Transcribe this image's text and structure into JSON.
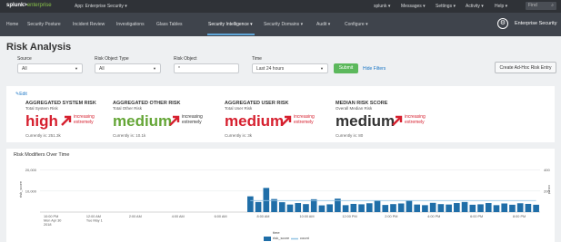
{
  "topbar": {
    "logo_main": "splunk>",
    "logo_sub": "enterprise",
    "app": "App: Enterprise Security ▾",
    "right": [
      "splunk ▾",
      "Messages ▾",
      "Settings ▾",
      "Activity ▾",
      "Help ▾"
    ],
    "find": "Find"
  },
  "nav": {
    "items": [
      "Home",
      "Security Posture",
      "Incident Review",
      "Investigations",
      "Glass Tables",
      "Security Intelligence ▾",
      "Security Domains ▾",
      "Audit ▾",
      "Configure ▾"
    ],
    "active_index": 5,
    "brand": "Enterprise Security"
  },
  "page": {
    "title": "Risk Analysis"
  },
  "filters": {
    "source_label": "Source",
    "source_value": "All",
    "type_label": "Risk Object Type",
    "type_value": "All",
    "object_label": "Risk Object",
    "object_value": "*",
    "time_label": "Time",
    "time_value": "Last 24 hours",
    "submit": "Submit",
    "hide": "Hide Filters",
    "adhoc": "Create Ad-Hoc Risk Entry"
  },
  "summary": {
    "edit": "Edit",
    "tiles": [
      {
        "heading": "AGGREGATED SYSTEM RISK",
        "sub": "Total System Risk",
        "value": "high",
        "trend1": "increasing",
        "trend2": "extremely",
        "current": "Currently is: 251.3k",
        "color": "#d6202f"
      },
      {
        "heading": "AGGREGATED OTHER RISK",
        "sub": "Total Other Risk",
        "value": "medium",
        "trend1": "increasing",
        "trend2": "extremely",
        "current": "Currently is: 10.1k",
        "color": "#65a637"
      },
      {
        "heading": "AGGREGATED USER RISK",
        "sub": "Total User Risk",
        "value": "medium",
        "trend1": "increasing",
        "trend2": "extremely",
        "current": "Currently is: 3k",
        "color": "#d6202f"
      },
      {
        "heading": "MEDIAN RISK SCORE",
        "sub": "Overall Median Risk",
        "value": "medium",
        "trend1": "increasing",
        "trend2": "extremely",
        "current": "Currently is: 80",
        "color": "#333333"
      }
    ]
  },
  "colors": {
    "bar": "#1f6ea8",
    "line": "#93c4e4",
    "trend_arrow": "#d6202f"
  },
  "chart_data": {
    "type": "bar",
    "title": "Risk Modifiers Over Time",
    "ylabel": "risk_score",
    "y2label": "count",
    "xlabel": "time",
    "left_ticks": [
      "20,000",
      "10,000"
    ],
    "right_ticks": [
      "400",
      "200"
    ],
    "x_ticks": [
      "10:00 PM\nMon Apr 30\n2018",
      "12:00 AM\nTue May 1",
      "2:00 AM",
      "4:00 AM",
      "6:00 AM",
      "8:00 AM",
      "10:00 AM",
      "12:00 PM",
      "2:00 PM",
      "4:00 PM",
      "6:00 PM",
      "8:00 PM"
    ],
    "ylim": [
      0,
      22000
    ],
    "y2lim": [
      0,
      480
    ],
    "series": [
      {
        "name": "risk_score",
        "values": [
          0,
          0,
          0,
          0,
          0,
          0,
          0,
          0,
          0,
          0,
          0,
          0,
          0,
          0,
          0,
          0,
          0,
          0,
          0,
          0,
          0,
          0,
          0,
          0,
          0,
          0,
          7500,
          4800,
          11500,
          6200,
          4700,
          3600,
          4300,
          3800,
          6100,
          3200,
          3700,
          6400,
          3300,
          3900,
          3700,
          4200,
          5600,
          3400,
          3800,
          4100,
          5400,
          3600,
          3300,
          4400,
          3800,
          3600,
          4300,
          4800,
          3500,
          3700,
          4300,
          3300,
          4100,
          3500,
          4200,
          3900,
          3500
        ]
      },
      {
        "name": "count",
        "values": [
          0,
          0,
          0,
          0,
          0,
          0,
          0,
          0,
          0,
          0,
          0,
          0,
          0,
          0,
          0,
          0,
          0,
          0,
          0,
          0,
          0,
          0,
          0,
          0,
          0,
          0,
          120,
          120,
          120,
          120,
          120,
          120,
          120,
          120,
          120,
          120,
          120,
          120,
          120,
          120,
          120,
          120,
          120,
          120,
          120,
          120,
          120,
          120,
          120,
          120,
          120,
          120,
          120,
          120,
          120,
          120,
          120,
          120,
          120,
          120,
          120,
          120,
          120
        ]
      }
    ]
  }
}
